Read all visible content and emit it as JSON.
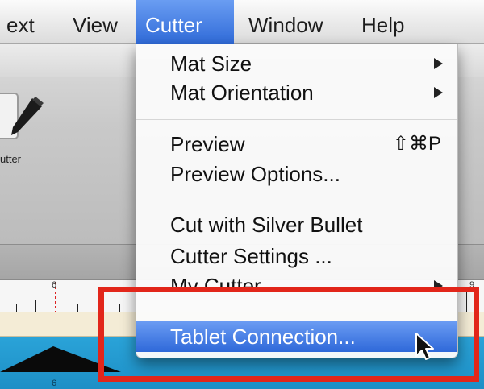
{
  "menubar": {
    "items": [
      {
        "label": "ext",
        "active": false
      },
      {
        "label": "View",
        "active": false
      },
      {
        "label": "Cutter",
        "active": true
      },
      {
        "label": "Window",
        "active": false
      },
      {
        "label": "Help",
        "active": false
      }
    ]
  },
  "toolbar": {
    "cutter_label": "utter"
  },
  "ruler": {
    "labels": [
      "6",
      "9"
    ]
  },
  "canvas": {
    "label": "6"
  },
  "cutter_menu": {
    "items": [
      {
        "label": "Mat Size",
        "submenu": true
      },
      {
        "label": "Mat Orientation",
        "submenu": true
      },
      {
        "label": "Preview",
        "shortcut": "⇧⌘P"
      },
      {
        "label": "Preview Options..."
      },
      {
        "label": "Cut with Silver Bullet"
      },
      {
        "label": "Cutter Settings ..."
      },
      {
        "label": "My Cutter",
        "submenu": true
      },
      {
        "label": "Tablet Connection...",
        "highlighted": true
      }
    ]
  },
  "colors": {
    "accent": "#2e68d9",
    "annotation": "#e2261a",
    "canvas_blue": "#1d8fc6"
  }
}
